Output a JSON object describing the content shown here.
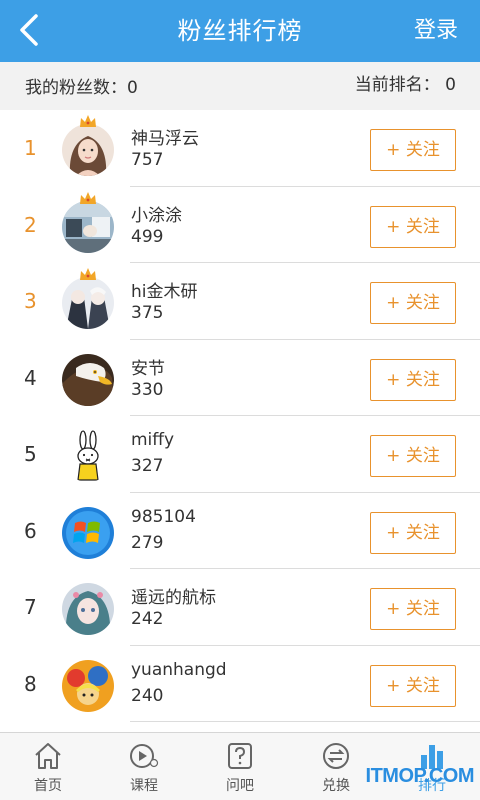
{
  "header": {
    "title": "粉丝排行榜",
    "login": "登录"
  },
  "stats": {
    "my_fans": "我的粉丝数：0",
    "current_rank": "当前排名： 0"
  },
  "follow_label": "+ 关注",
  "rows": [
    {
      "rank": "1",
      "name": "神马浮云",
      "fans": "757",
      "crown": true,
      "avatar": "avatar-girl"
    },
    {
      "rank": "2",
      "name": "小涂涂",
      "fans": "499",
      "crown": true,
      "avatar": "avatar-room"
    },
    {
      "rank": "3",
      "name": "hi金木研",
      "fans": "375",
      "crown": true,
      "avatar": "avatar-anime-pair"
    },
    {
      "rank": "4",
      "name": "安节",
      "fans": "330",
      "crown": false,
      "avatar": "avatar-eagle"
    },
    {
      "rank": "5",
      "name": "miffy",
      "fans": "327",
      "crown": false,
      "avatar": "avatar-rabbit"
    },
    {
      "rank": "6",
      "name": "985104",
      "fans": "279",
      "crown": false,
      "avatar": "avatar-windows"
    },
    {
      "rank": "7",
      "name": "遥远的航标",
      "fans": "242",
      "crown": false,
      "avatar": "avatar-anime-girl"
    },
    {
      "rank": "8",
      "name": "yuanhangd",
      "fans": "240",
      "crown": false,
      "avatar": "avatar-onepiece"
    }
  ],
  "tabs": [
    {
      "label": "首页",
      "icon": "home-icon"
    },
    {
      "label": "课程",
      "icon": "course-play-icon"
    },
    {
      "label": "问吧",
      "icon": "question-icon"
    },
    {
      "label": "兑换",
      "icon": "exchange-icon"
    },
    {
      "label": "排行",
      "icon": "ranking-icon",
      "active": true
    }
  ],
  "colors": {
    "header": "#3d9fe6",
    "accent": "#e8922d",
    "stats_bg": "#f2f2f2"
  },
  "watermark": "ITMOP.COM"
}
